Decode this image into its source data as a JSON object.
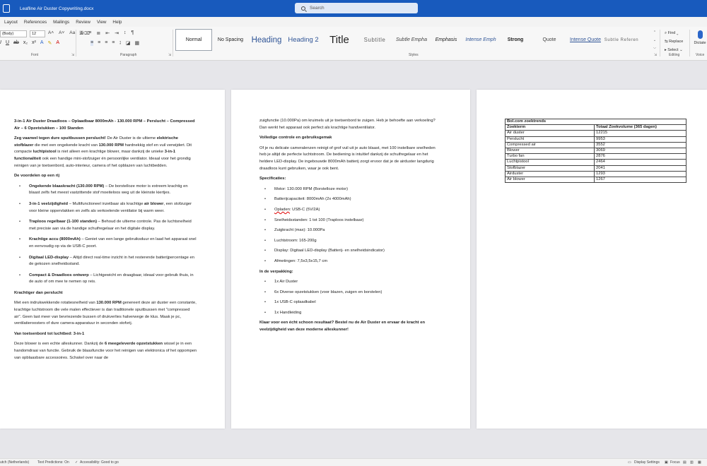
{
  "titlebar": {
    "doc_title": "Leafline Air Duster Copywriting.docx",
    "search_placeholder": "Search"
  },
  "tabs": [
    "Layout",
    "References",
    "Mailings",
    "Review",
    "View",
    "Help"
  ],
  "font": {
    "name": "(Body)",
    "size": "12"
  },
  "groups": {
    "font": "Font",
    "paragraph": "Paragraph",
    "styles": "Styles",
    "editing": "Editing",
    "voice": "Voice"
  },
  "styles": [
    "Normal",
    "No Spacing",
    "Heading",
    "Heading 2",
    "Title",
    "Subtitle",
    "Subtle Empha",
    "Emphasis",
    "Intense Emph",
    "Strong",
    "Quote",
    "Intense Quote",
    "Subtle Referen"
  ],
  "editing": {
    "find": "Find",
    "replace": "Replace",
    "select": "Select"
  },
  "voice": {
    "dictate": "Dictate"
  },
  "page1": {
    "title": "3-in-1 Air Duster Draadloos – Oplaadbaar 8000mAh - 130.000 RPM – Perslucht – Compressed Air – 6 Opzetstukken – 100 Standen",
    "intro_b1": "Zeg vaarwel tegen dure spuitbussen perslucht!",
    "intro_t1": " De Air Duster is de ultieme ",
    "intro_b2": "elektrische stofblazer",
    "intro_t2": " die met een ongekende kracht van ",
    "intro_b3": "130.000 RPM",
    "intro_t3": " hardnekkig stof en vuil verwijdert. Dit compacte ",
    "intro_b4": "luchtpistool",
    "intro_t4": " is niet alleen een krachtige blower, maar dankzij de unieke ",
    "intro_b5": "3-in-1 functionaliteit",
    "intro_t5": " ook een handige mini-stofzuiger én persoonlijke ventilator. Ideaal voor het grondig reinigen van je toetsenbord, auto-interieur, camera of het opblazen van luchtbedden.",
    "benefits_heading": "De voordelen op een rij",
    "benefits": [
      {
        "bold": "Ongekende blaaskracht (130.000 RPM)",
        "text": " – De borstelloze motor is extreem krachtig en blaast zelfs het meest vastzittende stof moeiteloos weg uit de kleinste kiertjes."
      },
      {
        "bold": "3-in-1 veelzijdigheid",
        "text": " – Multifunctioneel inzetbaar als krachtige ",
        "bold2": "air blower",
        "text2": ", een stofzuiger voor kleine oppervlakken en zelfs als verkoelende ventilator bij warm weer."
      },
      {
        "bold": "Traploos regelbaar (1-100 standen)",
        "text": " – Behoud de ultieme controle. Pas de luchtsnelheid met precisie aan via de handige schuifregelaar en het digitale display."
      },
      {
        "bold": "Krachtige accu (8000mAh)",
        "text": " – Geniet van een lange gebruiksduur en laad het apparaat snel en eenvoudig op via de USB-C poort."
      },
      {
        "bold": "Digitaal LED-display",
        "text": " – Altijd direct real-time inzicht in het resterende batterijpercentage en de gekozen snelheidsstand."
      },
      {
        "bold": "Compact & Draadloos ontwerp",
        "text": " – Lichtgewicht en draagbaar, ideaal voor gebruik thuis, in de auto of om mee te nemen op reis."
      }
    ],
    "section2_heading": "Krachtiger dan perslucht",
    "s2_t1": "Met een indrukwekkende rotatiesnelheid van ",
    "s2_b1": "130.000 RPM",
    "s2_t2": " genereert deze air duster een constante, krachtige luchtstroom die vele malen effectiever is dan traditionele spuitbussen met \"compressed air\". Geen last meer van bevriezende bussen of drukverlies halverwege de klus. Maak je pc, ventilatieroosters of dure camera-apparatuur in seconden stofvrij.",
    "section3_heading": "Van toetsenbord tot luchtbed: 3-in-1",
    "s3_t1": "Deze blower is een echte alleskunner. Dankzij de ",
    "s3_b1": "6 meegeleverde opzetstukken",
    "s3_t2": " wissel je in een handomdraai van functie. Gebruik de blaasfunctie voor het reinigen van elektronica of het oppompen van opblaasbare accessoires. Schakel over naar de"
  },
  "page2": {
    "cont": "zuigfunctie (10.000Pa) om kruimels uit je toetsenbord te zuigen. Heb je behoefte aan verkoeling? Dan werkt het apparaat ook perfect als krachtige handventilator.",
    "control_heading": "Volledige controle en gebruiksgemak",
    "control_text": "Of je nu delicate cameralenzen reinigt of grof vuil uit je auto blaast, met 100 instelbare snelheden heb je altijd de perfecte luchtstroom. De bediening is intuïtief dankzij de schuifregelaar en het heldere LED-display. De ingebouwde 8000mAh batterij zorgt ervoor dat je de airduster langdurig draadloos kunt gebruiken, waar je ook bent.",
    "specs_heading": "Specificaties:",
    "specs": [
      {
        "text": "Motor: 130.000 RPM (Borstelloze motor)"
      },
      {
        "text": "Batterijcapaciteit: 8000mAh (2x 4000mAh)"
      },
      {
        "spell": "Opladen",
        "text": ": USB-C (5V/2A)"
      },
      {
        "text": "Snelheidsstanden: 1 tot 100 (Traploos instelbaar)"
      },
      {
        "text": "Zuigkracht (max): 10.000Pa"
      },
      {
        "text": "Luchtstroom: 165-200g"
      },
      {
        "text": "Display: Digitaal LED-display (Batterij- en snelheidsindicator)"
      },
      {
        "text": "Afmetingen: 7,5x3,5x15,7 cm"
      }
    ],
    "box_heading": "In de verpakking:",
    "box": [
      "1x Air Duster",
      "6x Diverse opzetstukken (voor blazen, zuigen en borstelen)",
      "1x USB-C oplaadkabel",
      "1x Handleiding"
    ],
    "closing": "Klaar voor een écht schoon resultaat? Bestel nu de Air Duster en ervaar de kracht en veelzijdigheid van deze moderne alleskunner!"
  },
  "table": {
    "title": "Bol.com zoektrends",
    "headers": [
      "Zoekterm",
      "Totaal Zoekvolume (365 dagen)"
    ],
    "rows": [
      [
        "Air duster",
        "12215"
      ],
      [
        "Perslucht",
        "9953"
      ],
      [
        "Compressed air",
        "3552"
      ],
      [
        "Blower",
        "3069"
      ],
      [
        "Turbo fan",
        "2876"
      ],
      [
        "Luchtpistool",
        "2464"
      ],
      [
        "Stofblazer",
        "2041"
      ],
      [
        "Airduster",
        "1293"
      ],
      [
        "Air blower",
        "1267"
      ]
    ]
  },
  "statusbar": {
    "language": "utch (Netherlands)",
    "predictions": "Text Predictions: On",
    "accessibility": "Accessibility: Good to go",
    "display": "Display Settings",
    "focus": "Focus"
  }
}
